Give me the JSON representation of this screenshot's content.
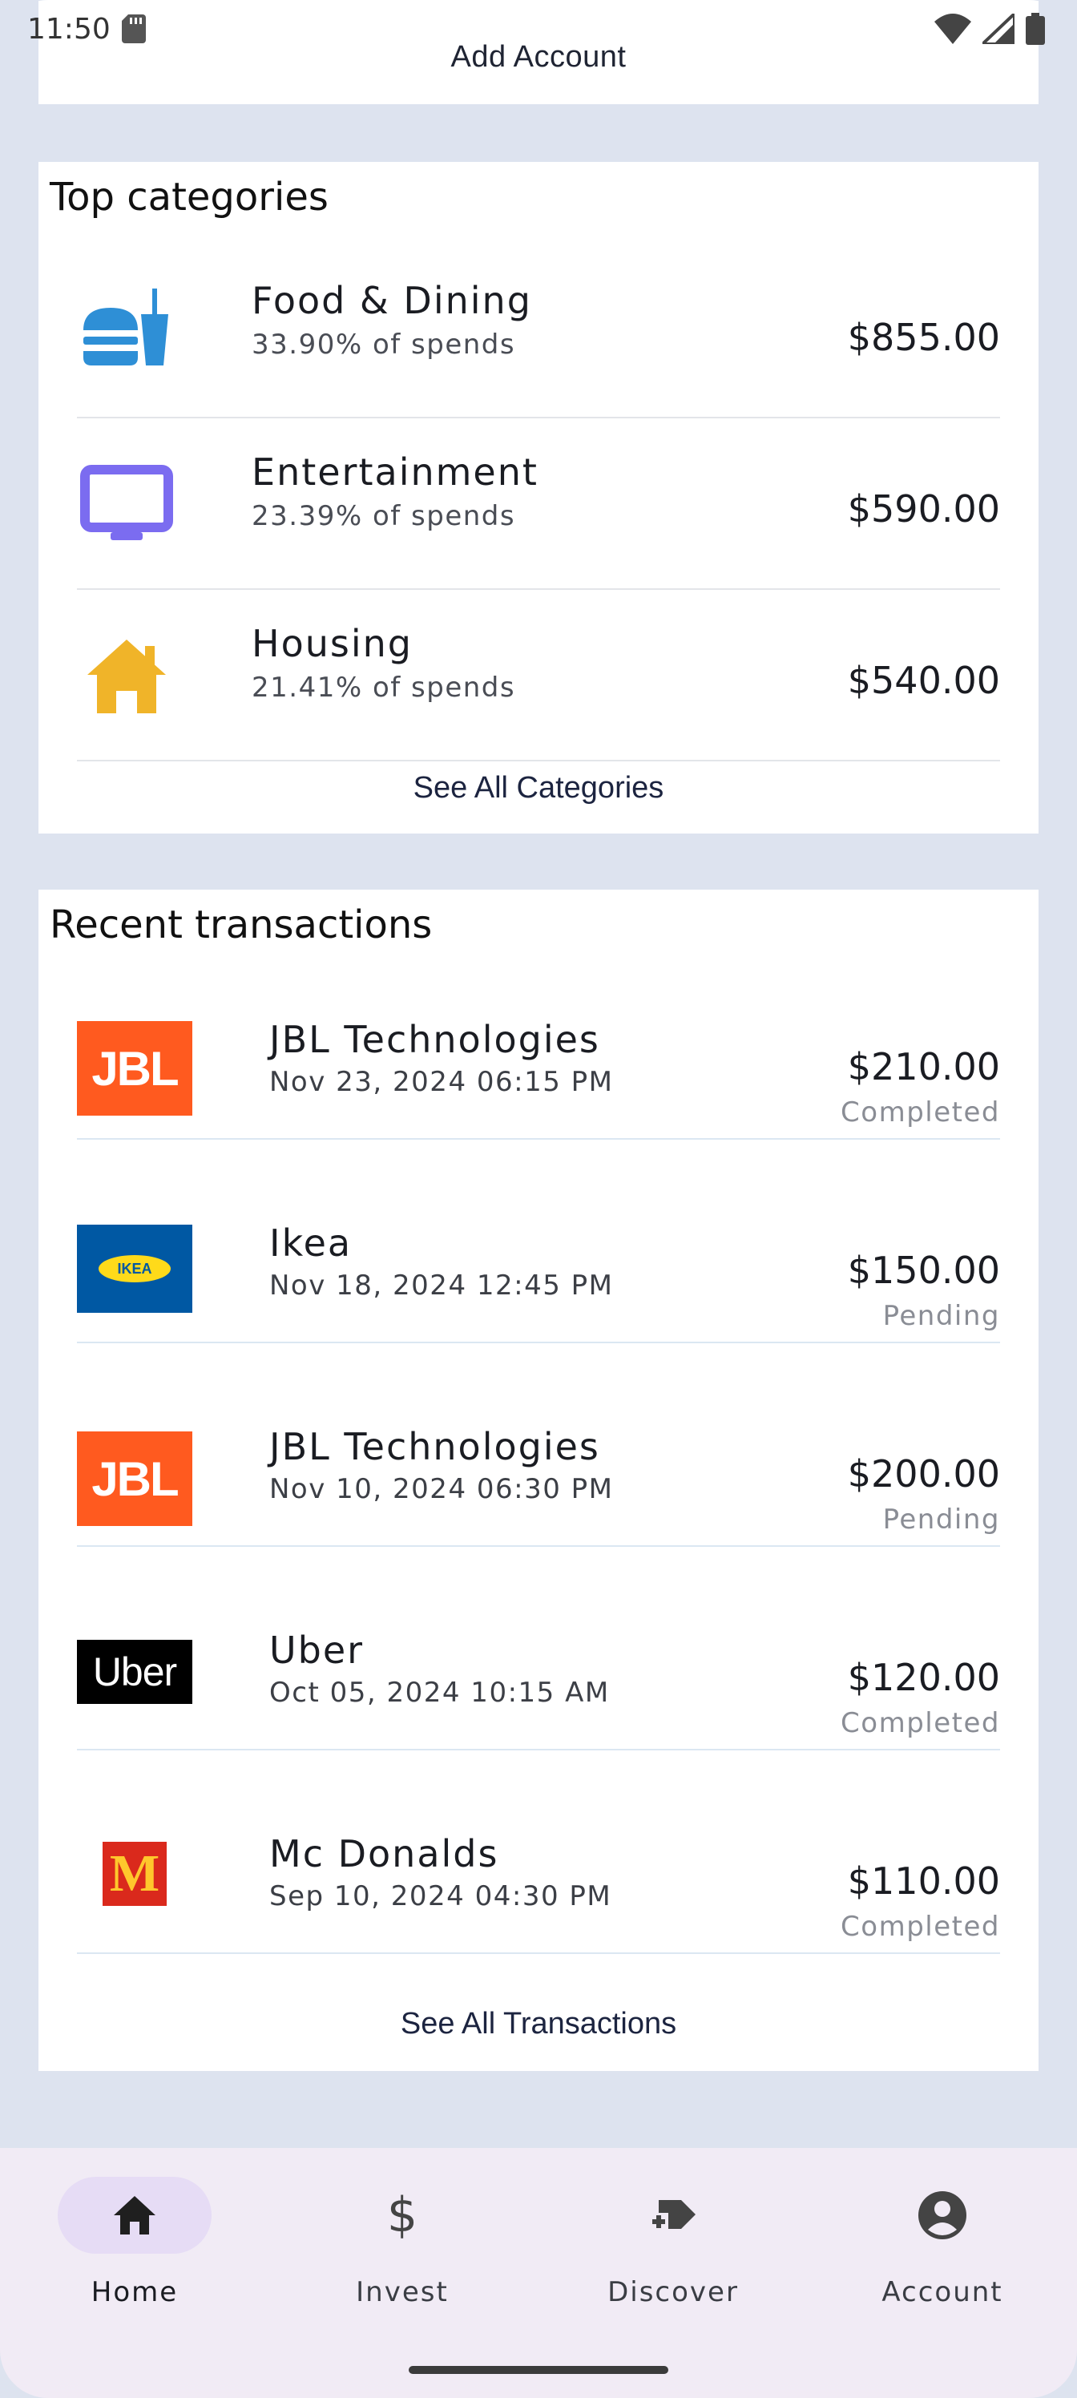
{
  "status_bar": {
    "time": "11:50",
    "icons": [
      "sd-card-icon",
      "wifi-icon",
      "signal-icon",
      "battery-icon"
    ]
  },
  "top_card": {
    "add_account_label": "Add Account"
  },
  "categories": {
    "title": "Top categories",
    "items": [
      {
        "name": "Food & Dining",
        "share": "33.90% of spends",
        "amount": "$855.00",
        "icon": "food-dining-icon",
        "color": "#2e8fd6"
      },
      {
        "name": "Entertainment",
        "share": "23.39% of spends",
        "amount": "$590.00",
        "icon": "tv-icon",
        "color": "#7b6cf0"
      },
      {
        "name": "Housing",
        "share": "21.41% of spends",
        "amount": "$540.00",
        "icon": "house-icon",
        "color": "#f0b429"
      }
    ],
    "see_all": "See All Categories"
  },
  "transactions": {
    "title": "Recent transactions",
    "items": [
      {
        "merchant": "JBL Technologies",
        "date": "Nov 23, 2024 06:15 PM",
        "amount": "$210.00",
        "status": "Completed",
        "logo": "jbl-logo",
        "logo_text": "JBL"
      },
      {
        "merchant": "Ikea",
        "date": "Nov 18, 2024 12:45 PM",
        "amount": "$150.00",
        "status": "Pending",
        "logo": "ikea-logo",
        "logo_text": "IKEA"
      },
      {
        "merchant": "JBL Technologies",
        "date": "Nov 10, 2024 06:30 PM",
        "amount": "$200.00",
        "status": "Pending",
        "logo": "jbl-logo",
        "logo_text": "JBL"
      },
      {
        "merchant": "Uber",
        "date": "Oct 05, 2024 10:15 AM",
        "amount": "$120.00",
        "status": "Completed",
        "logo": "uber-logo",
        "logo_text": "Uber"
      },
      {
        "merchant": "Mc Donalds",
        "date": "Sep 10, 2024 04:30 PM",
        "amount": "$110.00",
        "status": "Completed",
        "logo": "mcdonalds-logo",
        "logo_text": "M"
      }
    ],
    "see_all": "See All Transactions"
  },
  "bottom_nav": {
    "items": [
      {
        "label": "Home",
        "icon": "home-icon",
        "active": true
      },
      {
        "label": "Invest",
        "icon": "dollar-icon",
        "active": false
      },
      {
        "label": "Discover",
        "icon": "discover-icon",
        "active": false
      },
      {
        "label": "Account",
        "icon": "account-circle-icon",
        "active": false
      }
    ]
  },
  "colors": {
    "background": "#dde3ef",
    "card": "#ffffff",
    "nav_bar": "#f1ebf5",
    "nav_active_pill": "#e6dcf5",
    "jbl_orange": "#ff5a1f",
    "ikea_blue": "#0058a3",
    "ikea_yellow": "#ffda1a",
    "mcd_red": "#da291c",
    "mcd_yellow": "#ffc72c"
  }
}
